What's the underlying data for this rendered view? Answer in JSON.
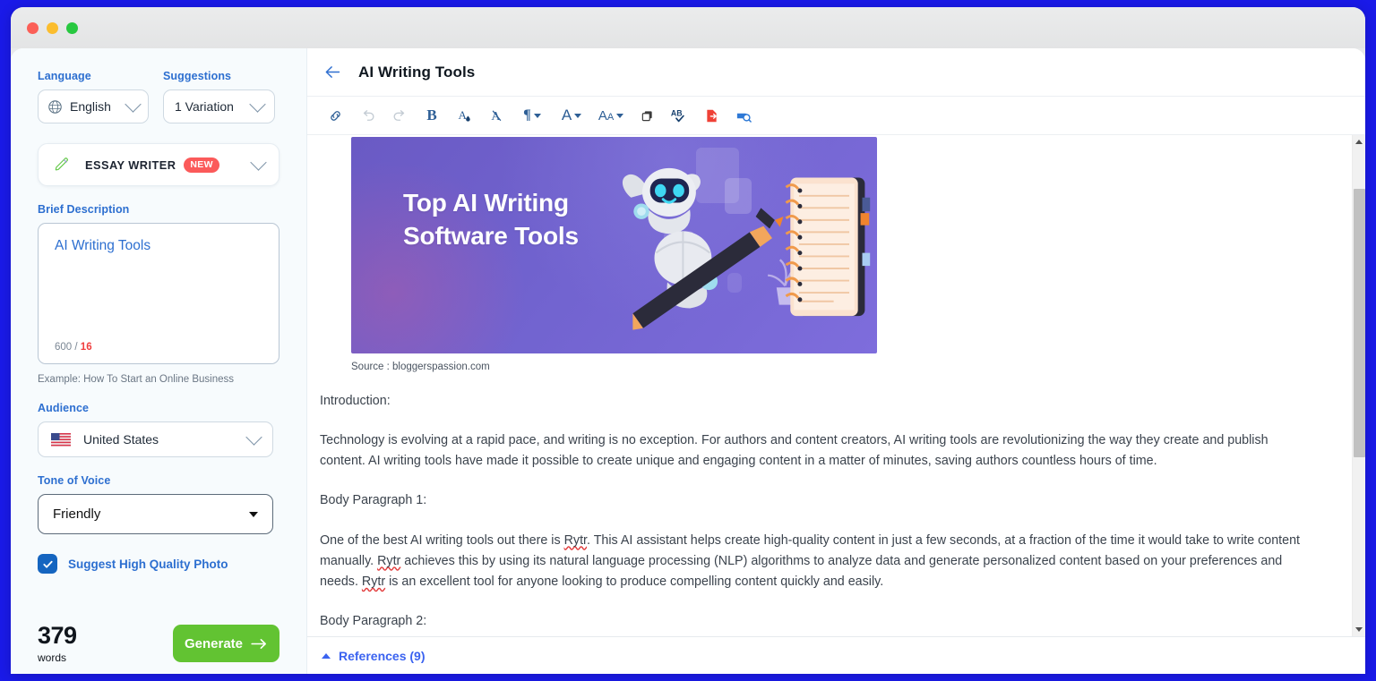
{
  "window": {
    "traffic_lights": [
      "close",
      "minimize",
      "maximize"
    ],
    "bg_color": "#1a1ae8"
  },
  "sidebar": {
    "language": {
      "label": "Language",
      "value": "English",
      "icon": "globe-icon"
    },
    "suggestions": {
      "label": "Suggestions",
      "value": "1 Variation"
    },
    "use_case": {
      "title": "ESSAY WRITER",
      "badge": "NEW",
      "icon": "pen-icon"
    },
    "brief": {
      "label": "Brief Description",
      "value": "AI Writing Tools",
      "char_limit": "600",
      "separator": "/",
      "char_used": "16",
      "hint": "Example: How To Start an Online Business"
    },
    "audience": {
      "label": "Audience",
      "value": "United States",
      "icon": "us-flag-icon"
    },
    "tone": {
      "label": "Tone of Voice",
      "value": "Friendly"
    },
    "photo_toggle": {
      "label": "Suggest High Quality Photo",
      "checked": true
    },
    "footer": {
      "word_count": "379",
      "word_label": "words",
      "generate_label": "Generate",
      "generate_color": "#62c332"
    }
  },
  "main": {
    "header": {
      "back_icon": "back-arrow-icon",
      "title": "AI Writing Tools"
    },
    "toolbar": {
      "items": [
        {
          "name": "link-icon",
          "glyph": "⎇",
          "type": "icon",
          "disabled": false
        },
        {
          "name": "undo-icon",
          "glyph": "↶",
          "type": "icon",
          "disabled": true
        },
        {
          "name": "redo-icon",
          "glyph": "↷",
          "type": "icon",
          "disabled": true
        },
        {
          "name": "bold-icon",
          "glyph": "B",
          "type": "text",
          "disabled": false
        },
        {
          "name": "text-color-icon",
          "glyph": "A",
          "type": "svg",
          "disabled": false
        },
        {
          "name": "clear-format-icon",
          "glyph": "A",
          "type": "svg",
          "disabled": false
        },
        {
          "name": "paragraph-icon",
          "glyph": "¶",
          "type": "menu",
          "disabled": false
        },
        {
          "name": "font-family-icon",
          "glyph": "A",
          "type": "menu",
          "disabled": false
        },
        {
          "name": "font-size-icon",
          "glyph": "Aa",
          "type": "menu",
          "disabled": false
        },
        {
          "name": "copy-icon",
          "glyph": "⧉",
          "type": "icon",
          "disabled": false
        },
        {
          "name": "spellcheck-icon",
          "glyph": "AB",
          "type": "svg",
          "disabled": false
        },
        {
          "name": "export-doc-icon",
          "glyph": "⮕",
          "type": "svg",
          "disabled": false
        },
        {
          "name": "plagiarism-check-icon",
          "glyph": "⌕",
          "type": "svg",
          "disabled": false
        }
      ]
    },
    "banner": {
      "title_line1": "Top AI Writing",
      "title_line2": "Software Tools",
      "alt": "robot writing on notepad illustration"
    },
    "source_caption": "Source : bloggerspassion.com",
    "paragraphs": [
      {
        "id": "intro-heading",
        "text": "Introduction:"
      },
      {
        "id": "intro-body",
        "text": "Technology is evolving at a rapid pace, and writing is no exception. For authors and content creators, AI writing tools are revolutionizing the way they create and publish content. AI writing tools have made it possible to create unique and engaging content in a matter of minutes, saving authors countless hours of time."
      },
      {
        "id": "body1-heading",
        "text": "Body Paragraph 1:"
      },
      {
        "id": "body1-part1",
        "text": "One of the best AI writing tools out there is "
      },
      {
        "id": "body1-misspell1",
        "text": "Rytr"
      },
      {
        "id": "body1-part2",
        "text": ". This AI assistant helps create high-quality content in just a few seconds, at a fraction of the time it would take to write content manually. "
      },
      {
        "id": "body1-misspell2",
        "text": "Rytr"
      },
      {
        "id": "body1-part3",
        "text": " achieves this by using its natural language processing (NLP) algorithms to analyze data and generate personalized content based on your preferences and needs. "
      },
      {
        "id": "body1-misspell3",
        "text": "Rytr"
      },
      {
        "id": "body1-part4",
        "text": " is an excellent tool for anyone looking to produce compelling content quickly and easily."
      },
      {
        "id": "body2-heading",
        "text": "Body Paragraph 2:"
      }
    ],
    "references": {
      "label": "References (9)",
      "count": 9,
      "expanded": true,
      "color": "#3b63f0"
    },
    "scrollbar": {
      "up_arrow": "scroll-up-arrow",
      "down_arrow": "scroll-down-arrow"
    }
  }
}
